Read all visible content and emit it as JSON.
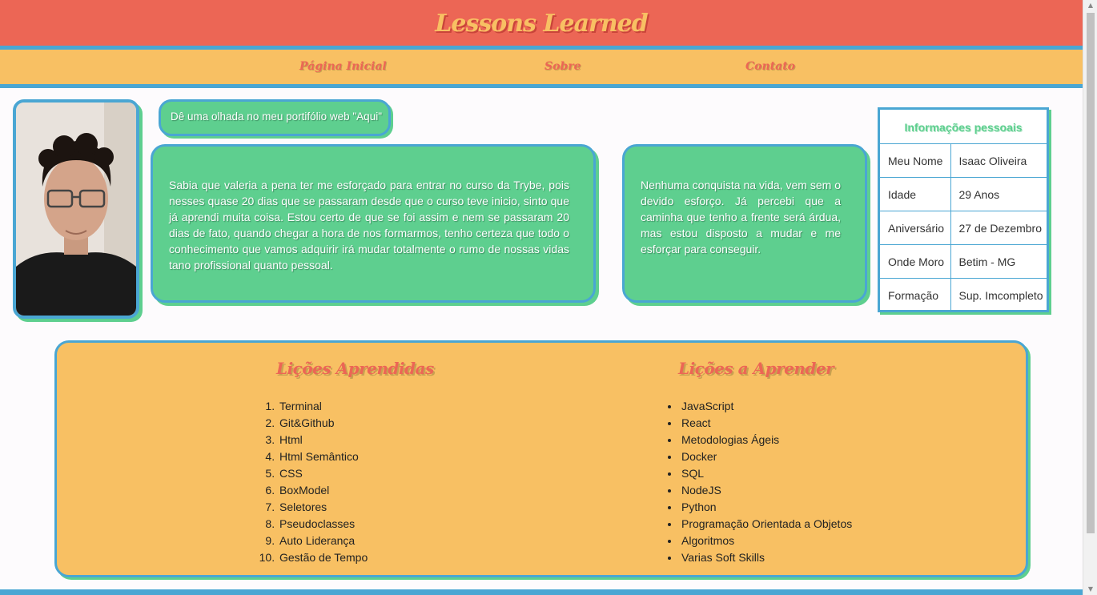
{
  "header": {
    "title": "Lessons Learned"
  },
  "nav": {
    "items": [
      {
        "label": "Página Inicial"
      },
      {
        "label": "Sobre"
      },
      {
        "label": "Contato"
      }
    ]
  },
  "portfolio": {
    "text": "Dê uma olhada no meu portifólio web \"Aqui\""
  },
  "cards": {
    "intro": "Sabia que valeria a pena ter me esforçado para entrar no curso da Trybe, pois nesses quase 20 dias que se passaram desde que o curso teve inicio, sinto que já aprendi muita coisa. Estou certo de que se foi assim e nem se passaram 20 dias de fato, quando chegar a hora de nos formarmos, tenho certeza que todo o conhecimento que vamos adquirir irá mudar totalmente o rumo de nossas vidas tano profissional quanto pessoal.",
    "quote": "Nenhuma conquista na vida, vem sem o devido esforço. Já percebi que a caminha que tenho a frente será árdua, mas estou disposto a mudar e me esforçar para conseguir."
  },
  "personal_info": {
    "caption": "Informações pessoais",
    "rows": [
      {
        "label": "Meu Nome",
        "value": "Isaac Oliveira"
      },
      {
        "label": "Idade",
        "value": "29 Anos"
      },
      {
        "label": "Aniversário",
        "value": "27 de Dezembro"
      },
      {
        "label": "Onde Moro",
        "value": "Betim - MG"
      },
      {
        "label": "Formação",
        "value": "Sup. Imcompleto"
      }
    ]
  },
  "lessons": {
    "learned_title": "Lições Aprendidas",
    "learned": [
      "Terminal",
      "Git&Github",
      "Html",
      "Html Semântico",
      "CSS",
      "BoxModel",
      "Seletores",
      "Pseudoclasses",
      "Auto Liderança",
      "Gestão de Tempo"
    ],
    "to_learn_title": "Lições a Aprender",
    "to_learn": [
      "JavaScript",
      "React",
      "Metodologias Ágeis",
      "Docker",
      "SQL",
      "NodeJS",
      "Python",
      "Programação Orientada a Objetos",
      "Algoritmos",
      "Varias Soft Skills"
    ]
  },
  "colors": {
    "header_bg": "#ec6655",
    "nav_bg": "#f8c063",
    "accent_blue": "#4aa6d3",
    "card_green": "#5ecf8f"
  }
}
